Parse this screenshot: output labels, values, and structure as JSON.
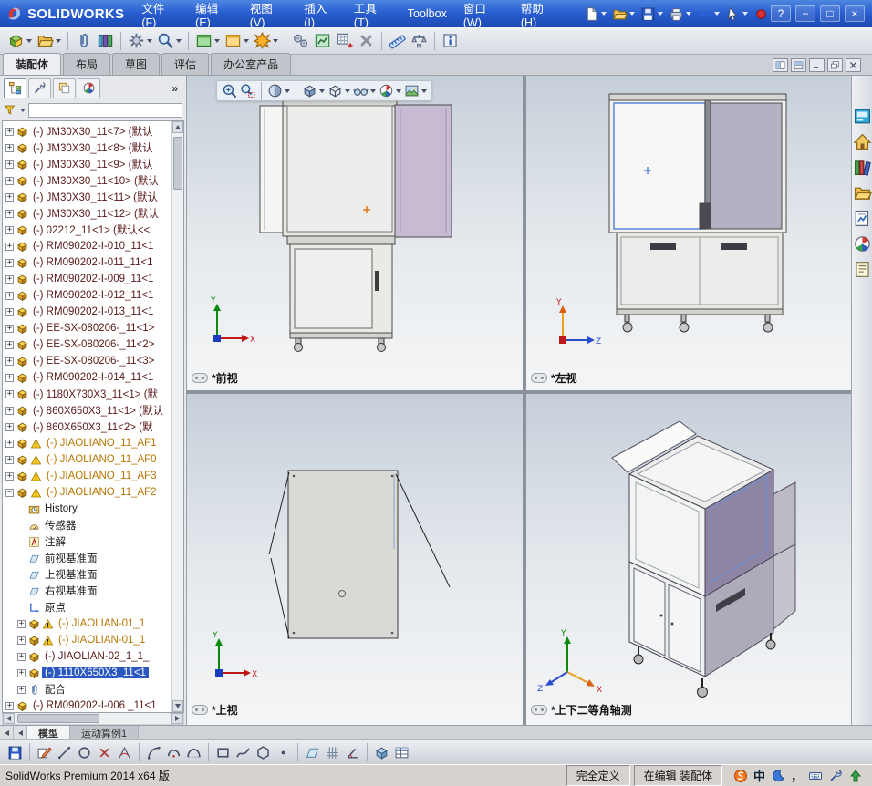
{
  "colors": {
    "titlebar_blue": "#2a5fd0",
    "selection_blue": "#2a58c0",
    "viewport_top": "#c6cfd9",
    "warning_orange": "#b87400"
  },
  "titlebar": {
    "brand": "SOLIDWORKS",
    "menus": [
      "文件(F)",
      "编辑(E)",
      "视图(V)",
      "插入(I)",
      "工具(T)",
      "Toolbox",
      "窗口(W)",
      "帮助(H)"
    ],
    "tools": [
      {
        "n": "new-doc",
        "dd": true
      },
      {
        "n": "open",
        "dd": true
      },
      {
        "n": "save",
        "dd": true
      },
      {
        "n": "print",
        "dd": true
      },
      {
        "n": "undo",
        "dd": true
      },
      {
        "n": "select",
        "dd": true
      },
      {
        "n": "rebuild",
        "dd": false
      }
    ],
    "window_buttons": [
      {
        "n": "help",
        "g": "?"
      },
      {
        "n": "minimize",
        "g": "−"
      },
      {
        "n": "restore",
        "g": "□"
      },
      {
        "n": "close",
        "g": "×"
      }
    ]
  },
  "toolbar2": {
    "tools": [
      {
        "n": "insert-comp",
        "dd": true
      },
      {
        "n": "open",
        "dd": true
      },
      {
        "sep": true
      },
      {
        "n": "mate"
      },
      {
        "n": "pattern"
      },
      {
        "sep": true
      },
      {
        "n": "move",
        "dd": true
      },
      {
        "n": "magnifier",
        "dd": true
      },
      {
        "sep": true
      },
      {
        "n": "window-green",
        "dd": true
      },
      {
        "n": "window-gold",
        "dd": true
      },
      {
        "n": "burst",
        "dd": true
      },
      {
        "sep": true
      },
      {
        "n": "gears"
      },
      {
        "n": "board-green"
      },
      {
        "n": "grid-plus"
      },
      {
        "n": "interfere"
      },
      {
        "sep": true
      },
      {
        "n": "measure"
      },
      {
        "n": "mass"
      },
      {
        "sep": true
      },
      {
        "n": "info"
      }
    ]
  },
  "command_tabs": {
    "tabs": [
      {
        "label": "装配体",
        "active": true
      },
      {
        "label": "布局",
        "active": false
      },
      {
        "label": "草图",
        "active": false
      },
      {
        "label": "评估",
        "active": false
      },
      {
        "label": "办公室产品",
        "active": false
      }
    ],
    "doc_buttons": [
      "split-h",
      "split-v",
      "win-min",
      "win-restore",
      "win-close"
    ]
  },
  "left_panel": {
    "manager_tabs": [
      {
        "icon": "fm-tree",
        "active": true
      },
      {
        "icon": "fm-props",
        "active": false
      },
      {
        "icon": "fm-config",
        "active": false
      },
      {
        "icon": "appearance",
        "active": false
      }
    ],
    "overflow_glyph": "»",
    "filter": {
      "value": "",
      "placeholder": ""
    }
  },
  "tree": {
    "items": [
      {
        "text": "(-) JM30X30_11<7> (默认",
        "icon": "part",
        "exp": "plus",
        "indent": 0,
        "tone": "comp"
      },
      {
        "text": "(-) JM30X30_11<8> (默认",
        "icon": "part",
        "exp": "plus",
        "indent": 0,
        "tone": "comp"
      },
      {
        "text": "(-) JM30X30_11<9> (默认",
        "icon": "part",
        "exp": "plus",
        "indent": 0,
        "tone": "comp"
      },
      {
        "text": "(-) JM30X30_11<10> (默认",
        "icon": "part",
        "exp": "plus",
        "indent": 0,
        "tone": "comp"
      },
      {
        "text": "(-) JM30X30_11<11> (默认",
        "icon": "part",
        "exp": "plus",
        "indent": 0,
        "tone": "comp"
      },
      {
        "text": "(-) JM30X30_11<12> (默认",
        "icon": "part",
        "exp": "plus",
        "indent": 0,
        "tone": "comp"
      },
      {
        "text": "(-) 02212_11<1> (默认<<",
        "icon": "part",
        "exp": "plus",
        "indent": 0,
        "tone": "comp"
      },
      {
        "text": "(-) RM090202-I-010_11<1",
        "icon": "part",
        "exp": "plus",
        "indent": 0,
        "tone": "comp"
      },
      {
        "text": "(-) RM090202-I-011_11<1",
        "icon": "part",
        "exp": "plus",
        "indent": 0,
        "tone": "comp"
      },
      {
        "text": "(-) RM090202-I-009_11<1",
        "icon": "part",
        "exp": "plus",
        "indent": 0,
        "tone": "comp"
      },
      {
        "text": "(-) RM090202-I-012_11<1",
        "icon": "part",
        "exp": "plus",
        "indent": 0,
        "tone": "comp"
      },
      {
        "text": "(-) RM090202-I-013_11<1",
        "icon": "part",
        "exp": "plus",
        "indent": 0,
        "tone": "comp"
      },
      {
        "text": "(-) EE-SX-080206-_11<1>",
        "icon": "part",
        "exp": "plus",
        "indent": 0,
        "tone": "comp"
      },
      {
        "text": "(-) EE-SX-080206-_11<2>",
        "icon": "part",
        "exp": "plus",
        "indent": 0,
        "tone": "comp"
      },
      {
        "text": "(-) EE-SX-080206-_11<3>",
        "icon": "part",
        "exp": "plus",
        "indent": 0,
        "tone": "comp"
      },
      {
        "text": "(-) RM090202-I-014_11<1",
        "icon": "part",
        "exp": "plus",
        "indent": 0,
        "tone": "comp"
      },
      {
        "text": "(-) 1180X730X3_11<1> (默",
        "icon": "part",
        "exp": "plus",
        "indent": 0,
        "tone": "comp"
      },
      {
        "text": "(-) 860X650X3_11<1> (默认",
        "icon": "part",
        "exp": "plus",
        "indent": 0,
        "tone": "comp"
      },
      {
        "text": "(-) 860X650X3_11<2> (默",
        "icon": "part",
        "exp": "plus",
        "indent": 0,
        "tone": "comp"
      },
      {
        "text": "(-) JIAOLIANO_11_AF1",
        "icon": "part",
        "warn": true,
        "exp": "plus",
        "indent": 0,
        "tone": "warn"
      },
      {
        "text": "(-) JIAOLIANO_11_AF0",
        "icon": "part",
        "warn": true,
        "exp": "plus",
        "indent": 0,
        "tone": "warn"
      },
      {
        "text": "(-) JIAOLIANO_11_AF3",
        "icon": "part",
        "warn": true,
        "exp": "plus",
        "indent": 0,
        "tone": "warn"
      },
      {
        "text": "(-) JIAOLIANO_11_AF2",
        "icon": "part",
        "warn": true,
        "exp": "minus",
        "indent": 0,
        "tone": "warn"
      },
      {
        "text": "History",
        "icon": "history",
        "exp": "",
        "indent": 1,
        "tone": "sub"
      },
      {
        "text": "传感器",
        "icon": "sensor",
        "exp": "",
        "indent": 1,
        "tone": "sub"
      },
      {
        "text": "注解",
        "icon": "ann",
        "exp": "",
        "indent": 1,
        "tone": "sub"
      },
      {
        "text": "前视基准面",
        "icon": "plane",
        "exp": "",
        "indent": 1,
        "tone": "sub"
      },
      {
        "text": "上视基准面",
        "icon": "plane",
        "exp": "",
        "indent": 1,
        "tone": "sub"
      },
      {
        "text": "右视基准面",
        "icon": "plane",
        "exp": "",
        "indent": 1,
        "tone": "sub"
      },
      {
        "text": "原点",
        "icon": "origin",
        "exp": "",
        "indent": 1,
        "tone": "sub"
      },
      {
        "text": "(-) JIAOLIAN-01_1",
        "icon": "part",
        "warn": true,
        "exp": "plus",
        "indent": 1,
        "tone": "warn"
      },
      {
        "text": "(-) JIAOLIAN-01_1",
        "icon": "part",
        "warn": true,
        "exp": "plus",
        "indent": 1,
        "tone": "warn"
      },
      {
        "text": "(-) JIAOLIAN-02_1_1_",
        "icon": "part",
        "exp": "plus",
        "indent": 1,
        "tone": "comp"
      },
      {
        "text": "(-) 1110X650X3_11<1",
        "icon": "part",
        "exp": "plus",
        "indent": 1,
        "tone": "comp",
        "sel": true
      },
      {
        "text": "配合",
        "icon": "mate",
        "exp": "plus",
        "indent": 1,
        "tone": "sub"
      },
      {
        "text": "(-) RM090202-I-006 _11<1",
        "icon": "part",
        "exp": "plus",
        "indent": 0,
        "tone": "comp"
      }
    ]
  },
  "viewport": {
    "views": [
      {
        "label": "*前视"
      },
      {
        "label": "*左视"
      },
      {
        "label": "*上视"
      },
      {
        "label": "*上下二等角轴测"
      }
    ],
    "headsup": [
      {
        "n": "zoom-fit"
      },
      {
        "n": "zoom-area"
      },
      {
        "sep": true
      },
      {
        "n": "section",
        "dd": true
      },
      {
        "sep": true
      },
      {
        "n": "view-cube",
        "dd": true
      },
      {
        "n": "display-style",
        "dd": true
      },
      {
        "n": "glasses",
        "dd": true
      },
      {
        "n": "appearance",
        "dd": true
      },
      {
        "n": "scene",
        "dd": true
      }
    ]
  },
  "taskpane": {
    "icons": [
      "resources",
      "home",
      "library",
      "folder",
      "palette",
      "appearance",
      "props"
    ]
  },
  "bottom": {
    "tabs": [
      {
        "label": "模型",
        "active": true
      },
      {
        "label": "运动算例1",
        "active": false
      }
    ]
  },
  "sketchbar": {
    "tools": [
      {
        "n": "save"
      },
      {
        "sep": true
      },
      {
        "n": "sketch"
      },
      {
        "n": "line"
      },
      {
        "n": "circle"
      },
      {
        "n": "erase"
      },
      {
        "n": "dim"
      },
      {
        "sep": true
      },
      {
        "n": "arc1"
      },
      {
        "n": "arc2"
      },
      {
        "n": "arc3"
      },
      {
        "sep": true
      },
      {
        "n": "rect"
      },
      {
        "n": "spline"
      },
      {
        "n": "polygon"
      },
      {
        "n": "point"
      },
      {
        "sep": true
      },
      {
        "n": "plane"
      },
      {
        "n": "grid"
      },
      {
        "n": "angle"
      },
      {
        "sep": true
      },
      {
        "n": "cube-blue"
      },
      {
        "n": "table"
      }
    ]
  },
  "statusbar": {
    "product": "SolidWorks Premium 2014 x64 版",
    "cells": [
      "完全定义",
      "在编辑 装配体"
    ],
    "ime_items": [
      {
        "n": "slogo"
      },
      {
        "t": "中",
        "n": "ime-lang"
      },
      {
        "n": "moon"
      },
      {
        "t": "，",
        "n": "ime-punct"
      },
      {
        "n": "keyboard"
      },
      {
        "n": "wrench"
      },
      {
        "n": "green-up"
      }
    ]
  }
}
